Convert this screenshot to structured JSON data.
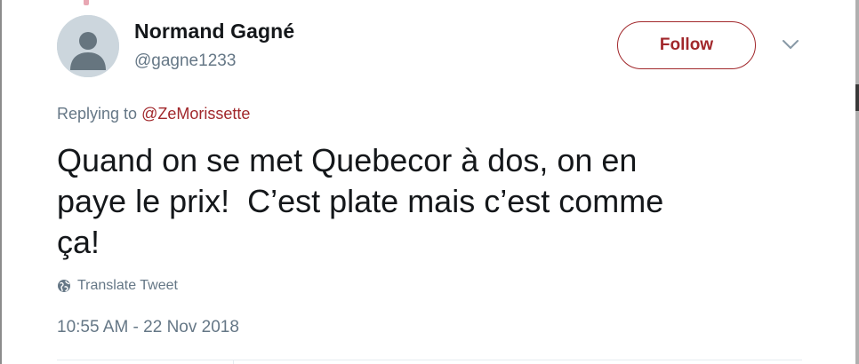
{
  "tweet": {
    "author": {
      "display_name": "Normand Gagné",
      "handle": "@gagne1233",
      "avatar_icon": "default-avatar-icon"
    },
    "follow_label": "Follow",
    "reply": {
      "prefix": "Replying to",
      "mention": "@ZeMorissette"
    },
    "text": "Quand on se met Quebecor à dos, on en\npaye le prix!  C’est plate mais c’est comme\nça!",
    "translate_label": "Translate Tweet",
    "timestamp": "10:55 AM - 22 Nov 2018"
  },
  "colors": {
    "accent": "#a1272b",
    "secondary_text": "#657786",
    "primary_text": "#14171a",
    "avatar_bg": "#ccd6dd",
    "avatar_fg": "#66757f"
  },
  "icons": {
    "caret": "chevron-down-icon",
    "translate": "globe-icon"
  }
}
